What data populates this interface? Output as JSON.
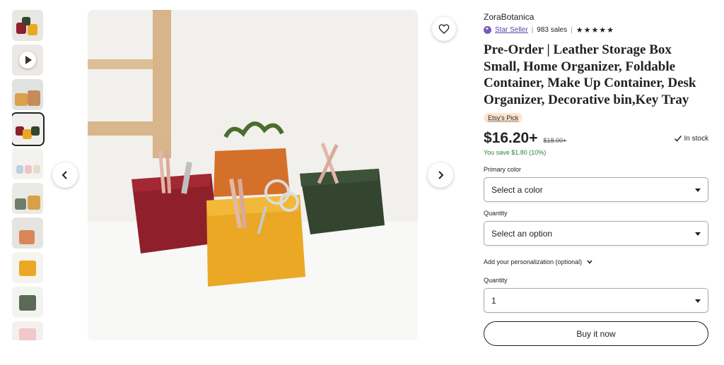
{
  "thumbnails": [
    {
      "label": "thumb-1"
    },
    {
      "label": "thumb-video"
    },
    {
      "label": "thumb-3"
    },
    {
      "label": "thumb-4"
    },
    {
      "label": "thumb-5"
    },
    {
      "label": "thumb-6"
    },
    {
      "label": "thumb-7"
    },
    {
      "label": "thumb-8"
    },
    {
      "label": "thumb-9"
    },
    {
      "label": "thumb-10"
    }
  ],
  "product": {
    "shop_name": "ZoraBotanica",
    "star_seller": "Star Seller",
    "sales": "983 sales",
    "rating_stars": "★★★★★",
    "title": "Pre-Order | Leather Storage Box Small, Home Organizer, Foldable Container, Make Up Container, Desk Organizer, Decorative bin,Key Tray",
    "badge": "Etsy's Pick",
    "price": "$16.20+",
    "old_price": "$18.00+",
    "stock": "In stock",
    "savings": "You save $1.80 (10%)"
  },
  "form": {
    "primary_color_label": "Primary color",
    "primary_color_value": "Select a color",
    "quantity_label_1": "Quantity",
    "quantity_option_value": "Select an option",
    "personalization": "Add your personalization (optional)",
    "quantity_label_2": "Quantity",
    "quantity_value": "1",
    "buy_now": "Buy it now"
  },
  "colors": {
    "red_box": "#8e1f2b",
    "orange_box": "#d4702a",
    "yellow_box": "#eaa824",
    "green_box": "#34452f",
    "savings_green": "#258635",
    "star_seller_purple": "#5b3ea8"
  }
}
